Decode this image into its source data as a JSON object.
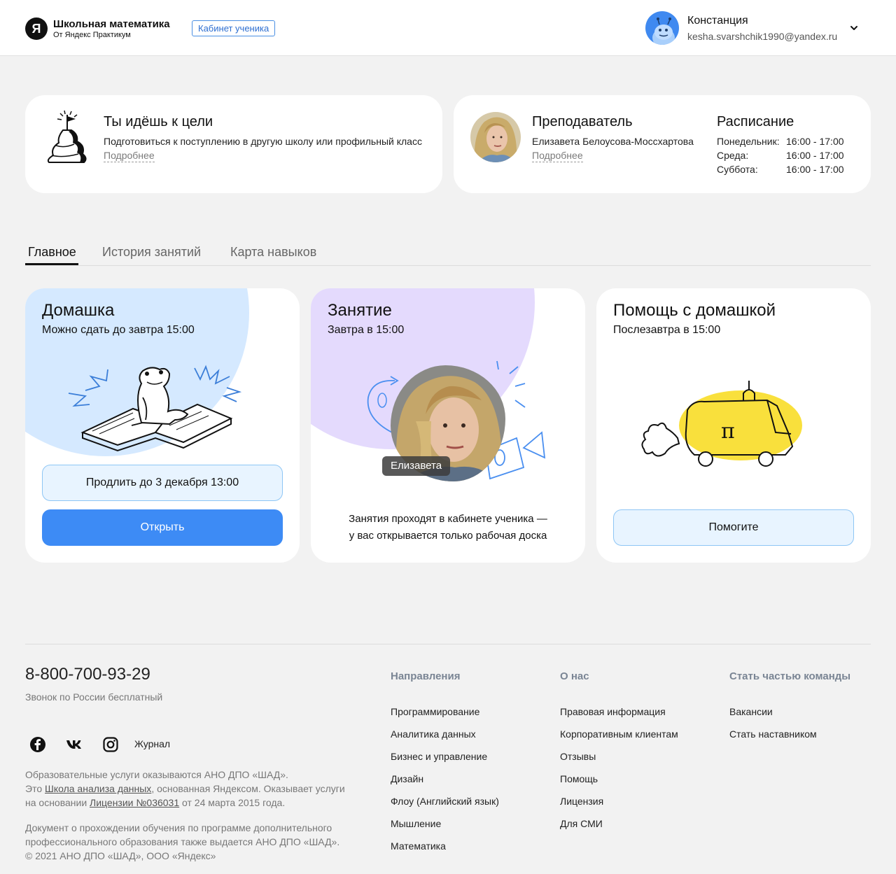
{
  "header": {
    "logo_letter": "Я",
    "logo_title": "Школьная математика",
    "logo_subtitle": "От Яндекс Практикум",
    "cabinet_badge": "Кабинет ученика",
    "user_name": "Констанция",
    "user_email": "kesha.svarshchik1990@yandex.ru"
  },
  "goal": {
    "title": "Ты идёшь к цели",
    "description": "Подготовиться к поступлению в другую школу или профильный класс",
    "more": "Подробнее"
  },
  "teacher": {
    "title": "Преподаватель",
    "name": "Елизавета Белоусова-Моссхартова",
    "more": "Подробнее"
  },
  "schedule": {
    "title": "Расписание",
    "rows": [
      {
        "day": "Понедельник:",
        "time": "16:00 - 17:00"
      },
      {
        "day": "Среда:",
        "time": "16:00 - 17:00"
      },
      {
        "day": "Суббота:",
        "time": "16:00 - 17:00"
      }
    ]
  },
  "tabs": [
    {
      "label": "Главное",
      "active": true
    },
    {
      "label": "История занятий",
      "active": false
    },
    {
      "label": "Карта навыков",
      "active": false
    }
  ],
  "homework": {
    "title": "Домашка",
    "subtitle": "Можно сдать до завтра 15:00",
    "extend_label": "Продлить до 3 декабря 13:00",
    "open_label": "Открыть"
  },
  "lesson": {
    "title": "Занятие",
    "subtitle": "Завтра в 15:00",
    "photo_label": "Елизавета",
    "note_line1": "Занятия проходят в кабинете ученика —",
    "note_line2": "у вас открывается только рабочая доска"
  },
  "help": {
    "title": "Помощь с домашкой",
    "subtitle": "Послезавтра в 15:00",
    "button_label": "Помогите"
  },
  "footer": {
    "phone": "8-800-700-93-29",
    "phone_note": "Звонок по России бесплатный",
    "journal": "Журнал",
    "legal1_line1": "Образовательные услуги оказываются АНО ДПО «ШАД».",
    "legal1_line2_pre": "Это ",
    "legal1_link1": "Школа анализа данных",
    "legal1_line2_post": ", основанная Яндексом. Оказывает услуги",
    "legal1_line3_pre": "на основании ",
    "legal1_link2": "Лицензии №036031",
    "legal1_line3_post": " от 24 марта 2015 года.",
    "legal2_line1": "Документ о прохождении обучения по программе дополнительного",
    "legal2_line2": "профессионального образования также выдается АНО ДПО «ШАД».",
    "legal2_line3": "© 2021 АНО ДПО «ШАД», ООО «Яндекс»",
    "columns": [
      {
        "title": "Направления",
        "links": [
          "Программирование",
          "Аналитика данных",
          "Бизнес и управление",
          "Дизайн",
          "Флоу (Английский язык)",
          "Мышление",
          "Математика"
        ]
      },
      {
        "title": "О нас",
        "links": [
          "Правовая информация",
          "Корпоративным клиентам",
          "Отзывы",
          "Помощь",
          "Лицензия",
          "Для СМИ"
        ]
      },
      {
        "title": "Стать частью команды",
        "links": [
          "Вакансии",
          "Стать наставником"
        ]
      }
    ]
  },
  "icons": {
    "social": [
      "facebook-icon",
      "vk-icon",
      "instagram-icon"
    ],
    "user_menu": "chevron-down-icon"
  },
  "colors": {
    "primary_button": "#3d8bf5",
    "homework_blob": "#d5e9ff",
    "lesson_blob": "#e4dafd",
    "help_accent": "#f9e03c"
  }
}
